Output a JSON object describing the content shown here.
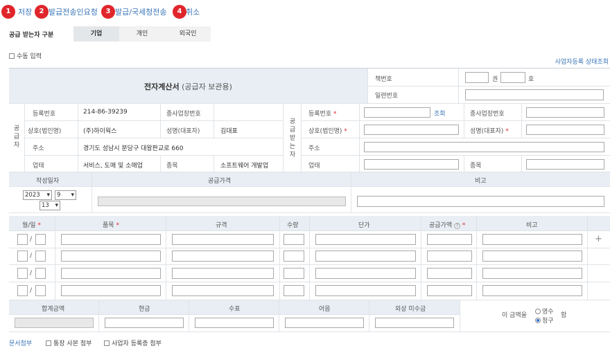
{
  "toolbar": {
    "items": [
      {
        "num": "1",
        "label": "저장"
      },
      {
        "num": "2",
        "label": "발급전송인요청"
      },
      {
        "num": "3",
        "label": "발급/국세청전송"
      },
      {
        "num": "4",
        "label": "취소"
      }
    ]
  },
  "recipient_type": {
    "label": "공급 받는자 구분",
    "options": [
      "기업",
      "개인",
      "외국인"
    ],
    "selected": "기업"
  },
  "manual_input_label": "수동 입력",
  "business_status_link": "사업자등록 상태조회",
  "invoice": {
    "title": "전자계산서",
    "title_sub": "(공급자 보관용)",
    "book_no_label": "책번호",
    "book_unit": "권",
    "ho_unit": "호",
    "serial_label": "일련번호"
  },
  "supplier": {
    "section_label": "공\n급\n자",
    "reg_no_label": "등록번호",
    "reg_no": "214-86-39239",
    "sub_biz_label": "종사업장번호",
    "name_label": "상호(법인명)",
    "name": "(주)하이웍스",
    "ceo_label": "성명(대표자)",
    "ceo": "김대표",
    "address_label": "주소",
    "address": "경기도 성남시 분당구 대왕판교로 660",
    "biz_type_label": "업태",
    "biz_type": "서비스, 도매 및 소매업",
    "biz_item_label": "종목",
    "biz_item": "소프트웨어 개발업"
  },
  "receiver": {
    "section_label": "공\n급\n받\n는\n자",
    "reg_no_label": "등록번호",
    "lookup_link": "조회",
    "sub_biz_label": "종사업장번호",
    "name_label": "상호(법인명)",
    "ceo_label": "성명(대표자)",
    "address_label": "주소",
    "biz_type_label": "업태",
    "biz_item_label": "종목"
  },
  "date_row": {
    "date_label": "작성일자",
    "amount_label": "공급가격",
    "note_label": "비고",
    "year": "2023",
    "month": "9",
    "day": "13"
  },
  "items_table": {
    "headers": [
      "월/일",
      "품목",
      "규격",
      "수량",
      "단가",
      "공급가액",
      "비고"
    ],
    "date_sep": "/",
    "add_icon": "+",
    "row_count": 4
  },
  "totals": {
    "headers": [
      "합계금액",
      "현금",
      "수표",
      "어음",
      "외상 미수금"
    ],
    "amount_prefix": "이 금액을",
    "receipt_option": "영수",
    "claim_option": "청구",
    "selected": "청구",
    "suffix": "함"
  },
  "footer": {
    "attach_link": "문서첨부",
    "bankbook_label": "통장 사본 첨부",
    "biz_reg_label": "사업자 등록증 첨부"
  }
}
